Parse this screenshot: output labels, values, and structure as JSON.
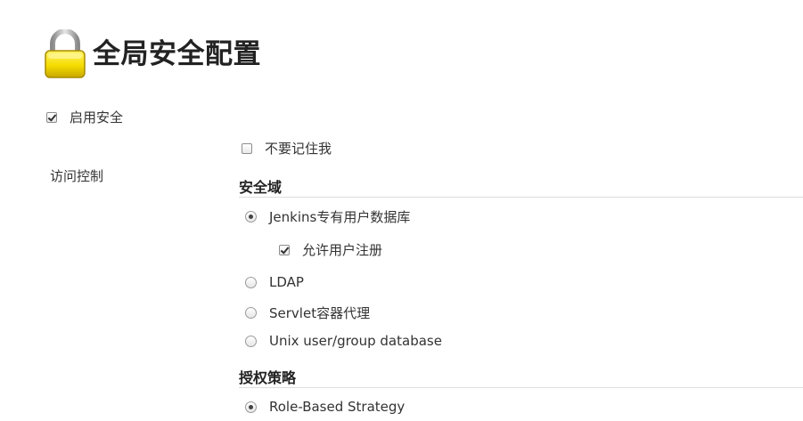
{
  "header": {
    "icon": "lock-icon",
    "title": "全局安全配置"
  },
  "enable_security": {
    "checked": true,
    "label": "启用安全"
  },
  "dont_remember_me": {
    "checked": false,
    "label": "不要记住我"
  },
  "access_control": {
    "label": "访问控制"
  },
  "security_realm": {
    "title": "安全域",
    "options": [
      {
        "label": "Jenkins专有用户数据库",
        "selected": true
      },
      {
        "label": "LDAP",
        "selected": false
      },
      {
        "label": "Servlet容器代理",
        "selected": false
      },
      {
        "label": "Unix user/group database",
        "selected": false
      }
    ],
    "allow_signup": {
      "checked": true,
      "label": "允许用户注册"
    }
  },
  "authorization": {
    "title": "授权策略",
    "options": [
      {
        "label": "Role-Based Strategy",
        "selected": true
      }
    ]
  },
  "colors": {
    "text": "#333333",
    "divider": "#dddddd",
    "lock_body": "#f2d600",
    "lock_shackle": "#b0b0b0"
  }
}
